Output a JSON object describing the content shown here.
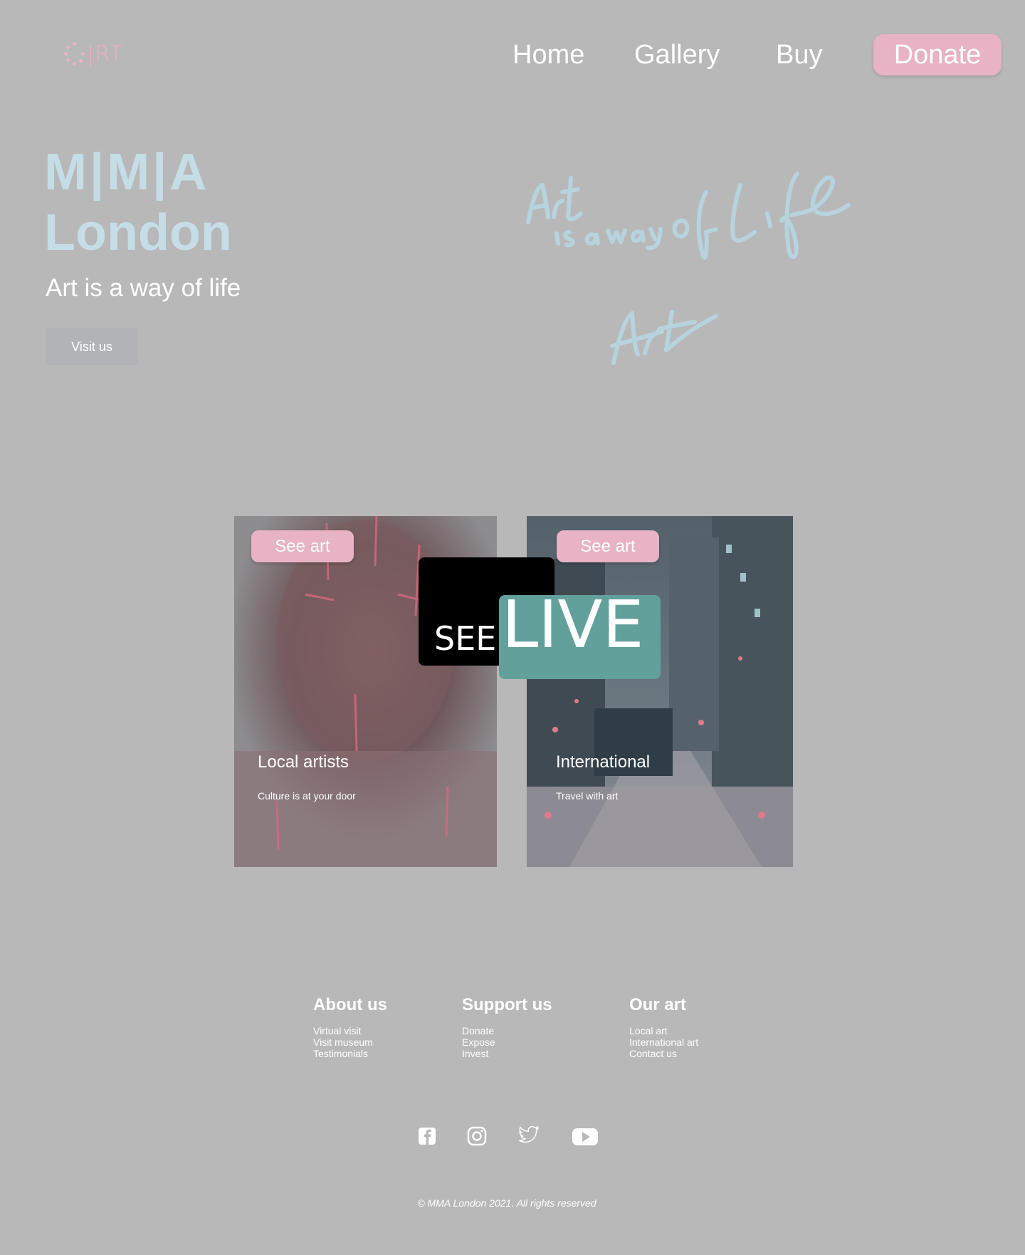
{
  "header": {
    "logo_text": "|RT",
    "nav": [
      "Home",
      "Gallery",
      "Buy"
    ],
    "donate_label": "Donate"
  },
  "hero": {
    "brand": "M|M|A",
    "city": "London",
    "tagline": "Art is a way of life",
    "visit_label": "Visit us",
    "script_lines": [
      "Art",
      "is a way",
      "of Life",
      "Art"
    ]
  },
  "cards": [
    {
      "button": "See art",
      "title": "Local artists",
      "subtitle": "Culture is at your door"
    },
    {
      "button": "See art",
      "title": "International",
      "subtitle": "Travel with art"
    }
  ],
  "promo": {
    "see": "SEE",
    "live": "LIVE"
  },
  "footer": {
    "columns": [
      {
        "heading": "About us",
        "links": [
          "Virtual visit",
          "Visit museum",
          "Testimonials"
        ]
      },
      {
        "heading": "Support us",
        "links": [
          "Donate",
          "Expose",
          "Invest"
        ]
      },
      {
        "heading": "Our art",
        "links": [
          "Local art",
          "International art",
          "Contact us"
        ]
      }
    ],
    "social_icons": [
      "facebook-icon",
      "instagram-icon",
      "twitter-icon",
      "youtube-icon"
    ],
    "copyright": "© MMA London 2021. All rights reserved"
  },
  "colors": {
    "background": "#b8b8b8",
    "accent_pink": "#e7b3c5",
    "hero_blue": "#c4dde6",
    "live_teal": "#62a19b"
  }
}
